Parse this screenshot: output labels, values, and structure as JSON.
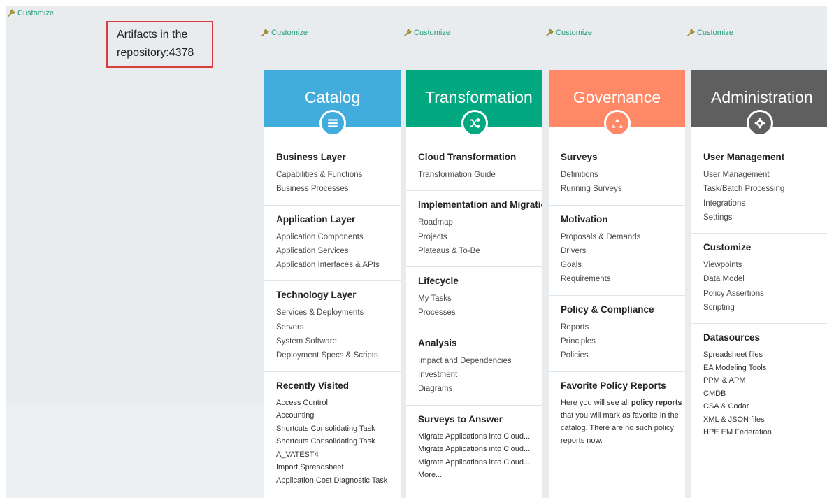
{
  "customize_label": "Customize",
  "artifacts": {
    "line1": "Artifacts in the",
    "line2": "repository:4378"
  },
  "colors": {
    "catalog": "#42addd",
    "transformation": "#02a880",
    "governance": "#ff8967",
    "administration": "#5f5f5f",
    "link_green": "#1f9d78",
    "highlight_red": "#d93c3c"
  },
  "columns": {
    "catalog": {
      "title": "Catalog",
      "icon": "list-icon",
      "sections": [
        {
          "title": "Business Layer",
          "items": [
            "Capabilities & Functions",
            "Business Processes"
          ]
        },
        {
          "title": "Application Layer",
          "items": [
            "Application Components",
            "Application Services",
            "Application Interfaces & APIs"
          ]
        },
        {
          "title": "Technology Layer",
          "items": [
            "Services & Deployments",
            "Servers",
            "System Software",
            "Deployment Specs & Scripts"
          ]
        },
        {
          "title": "Recently Visited",
          "items": [
            "Access Control",
            "Accounting",
            "Shortcuts Consolidating Task",
            "Shortcuts Consolidating Task",
            "A_VATEST4",
            "Import Spreadsheet",
            "Application Cost Diagnostic Task"
          ]
        }
      ]
    },
    "transformation": {
      "title": "Transformation",
      "icon": "shuffle-icon",
      "sections": [
        {
          "title": "Cloud Transformation",
          "items": [
            "Transformation Guide"
          ]
        },
        {
          "title": "Implementation and Migration",
          "items": [
            "Roadmap",
            "Projects",
            "Plateaus & To-Be"
          ]
        },
        {
          "title": "Lifecycle",
          "items": [
            "My Tasks",
            "Processes"
          ]
        },
        {
          "title": "Analysis",
          "items": [
            "Impact and Dependencies",
            "Investment",
            "Diagrams"
          ]
        },
        {
          "title": "Surveys to Answer",
          "items": [
            "Migrate Applications into Cloud...",
            "Migrate Applications into Cloud...",
            "Migrate Applications into Cloud...",
            "More..."
          ]
        }
      ]
    },
    "governance": {
      "title": "Governance",
      "icon": "recycle-icon",
      "sections": [
        {
          "title": "Surveys",
          "items": [
            "Definitions",
            "Running Surveys"
          ]
        },
        {
          "title": "Motivation",
          "items": [
            "Proposals & Demands",
            "Drivers",
            "Goals",
            "Requirements"
          ]
        },
        {
          "title": "Policy & Compliance",
          "items": [
            "Reports",
            "Principles",
            "Policies"
          ]
        },
        {
          "title": "Favorite Policy Reports",
          "text1": "Here you will see all ",
          "text_bold": "policy reports",
          "text2": "that you will mark as favorite in the",
          "text3": "catalog. There are no such policy",
          "text4": "reports now."
        }
      ]
    },
    "administration": {
      "title": "Administration",
      "icon": "gear-icon",
      "sections": [
        {
          "title": "User Management",
          "items": [
            "User Management",
            "Task/Batch Processing",
            "Integrations",
            "Settings"
          ]
        },
        {
          "title": "Customize",
          "items": [
            "Viewpoints",
            "Data Model",
            "Policy Assertions",
            "Scripting"
          ]
        },
        {
          "title": "Datasources",
          "items": [
            "Spreadsheet files",
            "EA Modeling Tools",
            "PPM & APM",
            "CMDB",
            "CSA & Codar",
            "XML & JSON files",
            "HPE EM Federation"
          ]
        }
      ]
    }
  }
}
